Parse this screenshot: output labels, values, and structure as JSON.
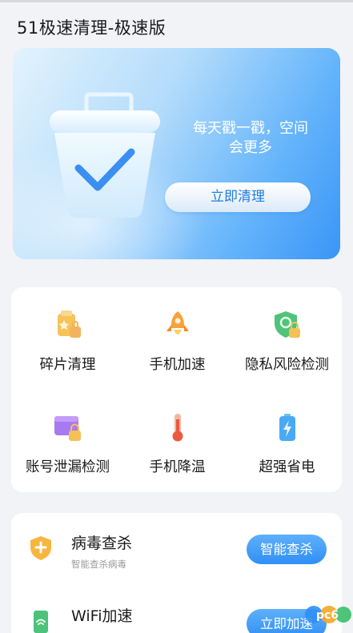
{
  "app": {
    "title": "51极速清理-极速版"
  },
  "hero": {
    "message_line1": "每天戳一戳，空间",
    "message_line2": "会更多",
    "button_label": "立即清理",
    "icon": "trash-bin-check-icon"
  },
  "tools": [
    {
      "label": "碎片清理",
      "icon": "fragment-clean-icon"
    },
    {
      "label": "手机加速",
      "icon": "rocket-icon"
    },
    {
      "label": "隐私风险检测",
      "icon": "privacy-shield-lock-icon"
    },
    {
      "label": "账号泄漏检测",
      "icon": "wallet-lock-icon"
    },
    {
      "label": "手机降温",
      "icon": "thermometer-icon"
    },
    {
      "label": "超强省电",
      "icon": "battery-bolt-icon"
    }
  ],
  "features": [
    {
      "title": "病毒查杀",
      "subtitle": "智能查杀病毒",
      "button_label": "智能查杀",
      "icon": "virus-shield-icon"
    },
    {
      "title": "WiFi加速",
      "subtitle": "",
      "button_label": "立即加速",
      "icon": "wifi-phone-icon"
    }
  ],
  "watermark": {
    "text": "pc6"
  },
  "colors": {
    "accent": "#2f8ff5",
    "background": "#f2f3f7",
    "card": "#ffffff"
  }
}
